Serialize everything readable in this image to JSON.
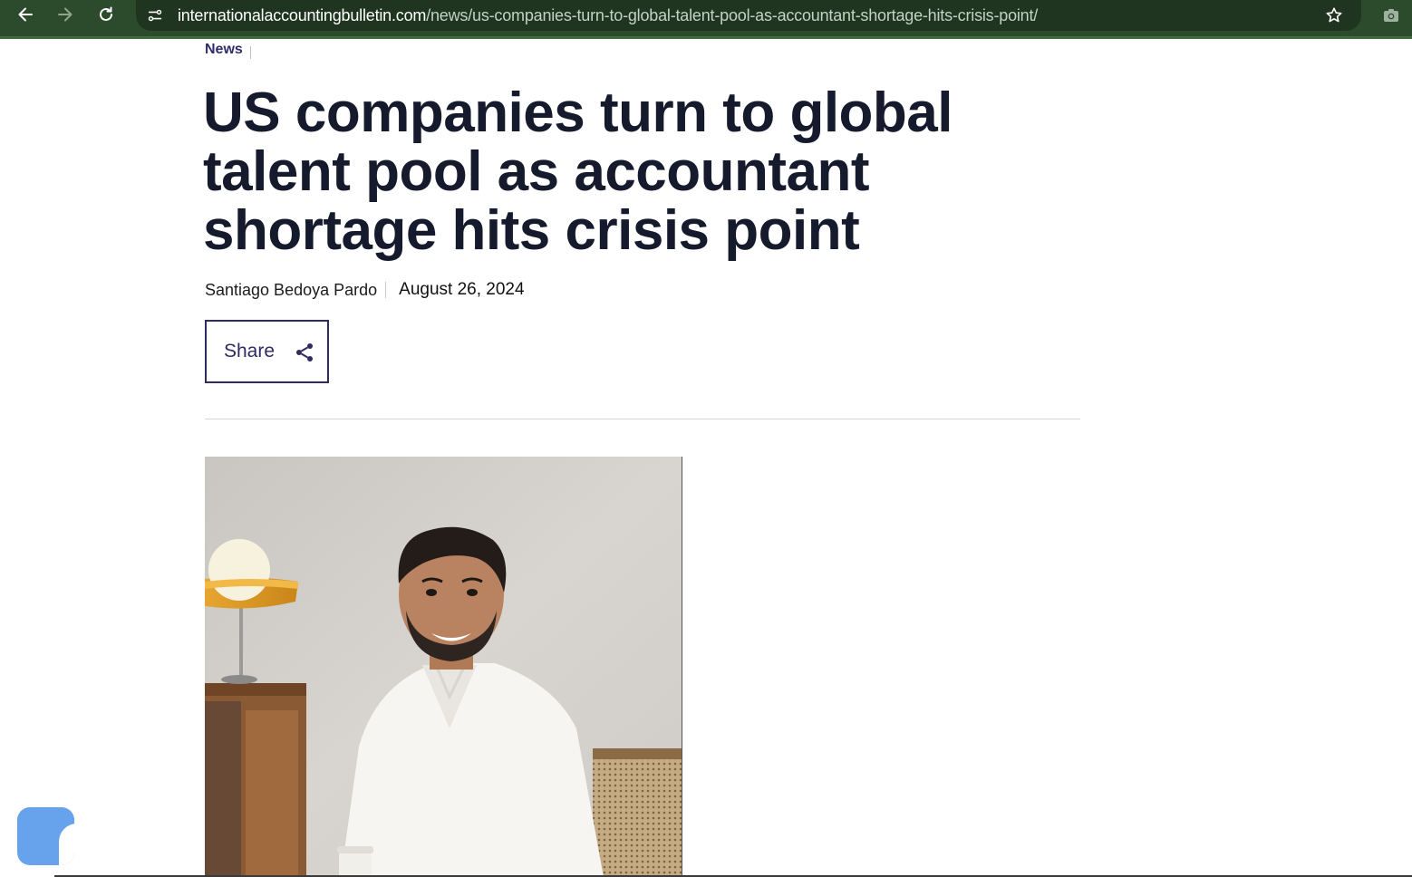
{
  "browser": {
    "url_host": "internationalaccountingbulletin.com",
    "url_path": "/news/us-companies-turn-to-global-talent-pool-as-accountant-shortage-hits-crisis-point/",
    "icons": [
      "back-icon",
      "forward-icon",
      "reload-icon",
      "site-info-icon",
      "bookmark-star-icon",
      "camera-icon"
    ],
    "toolbar_color": "#2c4a2c"
  },
  "breadcrumb": {
    "category": "News"
  },
  "article": {
    "title": "US companies turn to global talent pool as accountant shortage hits crisis point",
    "author": "Santiago Bedoya Pardo",
    "date": "August 26, 2024",
    "share_label": "Share"
  },
  "colors": {
    "title": "#151a2d",
    "accent": "#2d2b62",
    "chat_widget": "#66a3ec"
  }
}
